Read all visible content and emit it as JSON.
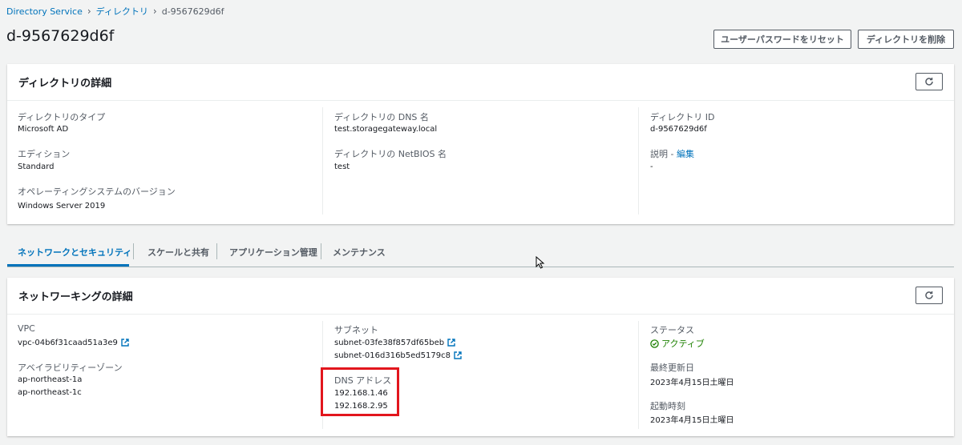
{
  "breadcrumb": {
    "item1": "Directory Service",
    "item2": "ディレクトリ",
    "current": "d-9567629d6f"
  },
  "page_title": "d-9567629d6f",
  "buttons": {
    "reset_password": "ユーザーパスワードをリセット",
    "delete_directory": "ディレクトリを削除"
  },
  "details": {
    "title": "ディレクトリの詳細",
    "type_label": "ディレクトリのタイプ",
    "type_value": "Microsoft AD",
    "edition_label": "エディション",
    "edition_value": "Standard",
    "os_label": "オペレーティングシステムのバージョン",
    "os_value": "Windows Server 2019",
    "dns_label": "ディレクトリの DNS 名",
    "dns_value": "test.storagegateway.local",
    "netbios_label": "ディレクトリの NetBIOS 名",
    "netbios_value": "test",
    "id_label": "ディレクトリ ID",
    "id_value": "d-9567629d6f",
    "desc_label": "説明 - ",
    "desc_edit": "編集",
    "desc_value": "-"
  },
  "tabs": [
    "ネットワークとセキュリティ",
    "スケールと共有",
    "アプリケーション管理",
    "メンテナンス"
  ],
  "networking": {
    "title": "ネットワーキングの詳細",
    "vpc_label": "VPC",
    "vpc_value": "vpc-04b6f31caad51a3e9",
    "az_label": "アベイラビリティーゾーン",
    "az_values": [
      "ap-northeast-1a",
      "ap-northeast-1c"
    ],
    "subnet_label": "サブネット",
    "subnets": [
      "subnet-03fe38f857df65beb",
      "subnet-016d316b5ed5179c8"
    ],
    "dns_label": "DNS アドレス",
    "dns_values": [
      "192.168.1.46",
      "192.168.2.95"
    ],
    "status_label": "ステータス",
    "status_value": "アクティブ",
    "updated_label": "最終更新日",
    "updated_value": "2023年4月15日土曜日",
    "launched_label": "起動時刻",
    "launched_value": "2023年4月15日土曜日"
  },
  "colors": {
    "link": "#0073bb",
    "success": "#1d8102",
    "highlight": "#e2161d"
  }
}
